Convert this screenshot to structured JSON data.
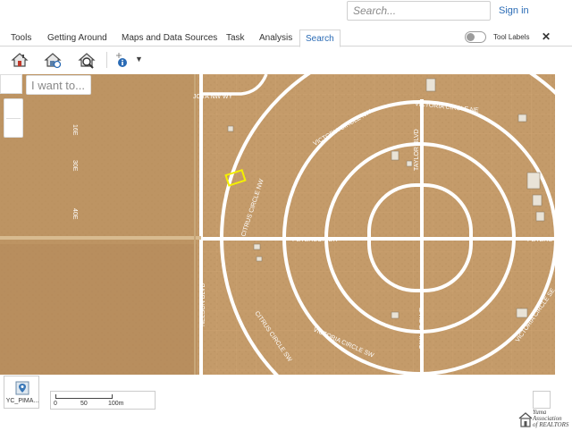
{
  "header": {
    "search_placeholder": "Search...",
    "sign_in_label": "Sign in"
  },
  "ribbon": {
    "tabs": [
      {
        "label": "Tools"
      },
      {
        "label": "Getting Around"
      },
      {
        "label": "Maps and Data Sources"
      },
      {
        "label": "Task"
      },
      {
        "label": "Analysis"
      },
      {
        "label": "Search"
      }
    ],
    "active_tab": "Search",
    "tool_labels_label": "Tool Labels",
    "tool_labels_on": false,
    "close_symbol": "✕"
  },
  "toolbar": {
    "tools": [
      {
        "icon": "house-search-icon"
      },
      {
        "icon": "house-identify-icon"
      },
      {
        "icon": "house-find-icon"
      },
      {
        "icon": "identify-info-icon"
      }
    ],
    "dropdown_symbol": "▼"
  },
  "map": {
    "i_want_to_placeholder": "I want to...",
    "road_labels": {
      "joya": "JOYA NW WY",
      "victoria_ne": "VICTORIA CIRCLE NE",
      "victoria_nw": "VICTORIA CIRCLE NW",
      "taylor_n": "TAYLOR BLVD",
      "citrus_nw": "CITRUS CIRCLE NW",
      "peterson_w": "PETERSON DR",
      "peterson_e": "PETERS",
      "nelson": "NELSON BLVD",
      "citrus_sw": "CITRUS CIRCLE SW",
      "victoria_sw": "VICTORIA CIRCLE SW",
      "taylor_s": "TAYLOR BLVD",
      "victoria_se": "VICTORIA CIRCLE SE",
      "west_ave_a": "16E",
      "west_ave_b": "30E",
      "west_ave_c": "40E"
    },
    "colors": {
      "desert": "#c49b6a",
      "desert_dark": "#b68b5c",
      "road": "#ffffff",
      "parcel_line": "#d9b17a",
      "selected_parcel": "#f4f000"
    }
  },
  "bottom": {
    "layer_name": "YC_PIMA...",
    "scale_ticks": [
      "0",
      "50",
      "100m"
    ],
    "logo_text": "Yuma\nAssociation\nof REALTORS"
  }
}
